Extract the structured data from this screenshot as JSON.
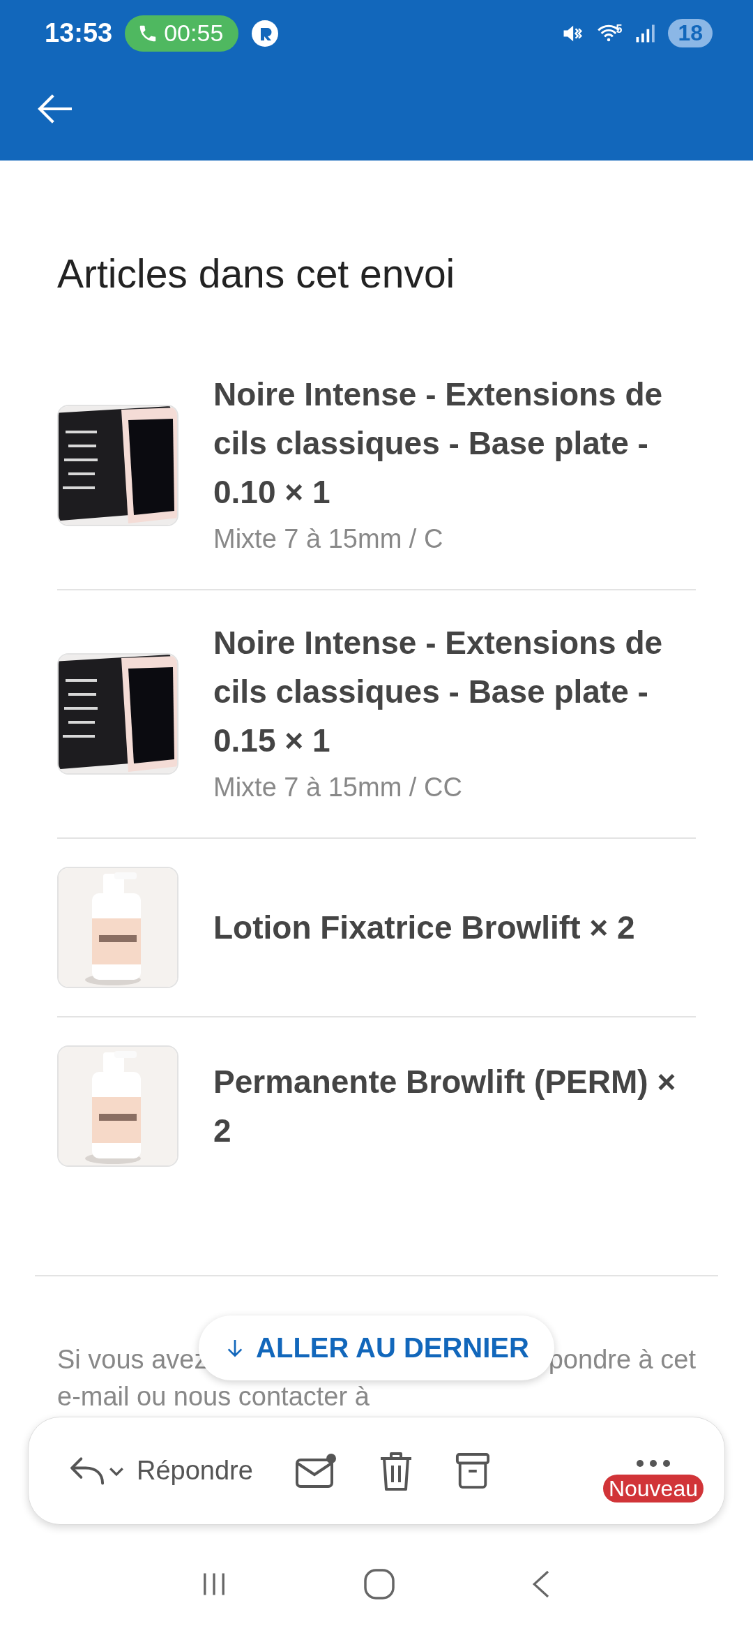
{
  "status_bar": {
    "time": "13:53",
    "call_timer": "00:55",
    "wifi_band": "5",
    "battery": "18"
  },
  "section_title": "Articles dans cet envoi",
  "items": [
    {
      "name": "Noire Intense - Extensions de cils classiques - Base plate - 0.10 × 1",
      "variant": "Mixte 7 à 15mm / C",
      "kind": "lash-palette"
    },
    {
      "name": "Noire Intense - Extensions de cils classiques - Base plate - 0.15 × 1",
      "variant": "Mixte 7 à 15mm / CC",
      "kind": "lash-palette"
    },
    {
      "name": "Lotion Fixatrice Browlift × 2",
      "kind": "bottle"
    },
    {
      "name": "Permanente Browlift (PERM) × 2",
      "kind": "bottle"
    }
  ],
  "jump_button": {
    "label": "ALLER AU DERNIER"
  },
  "message_text": {
    "line_1_start": "Si vous avez",
    "line_1_end": "pondre à cet",
    "line_2": "e-mail ou nous contacter à"
  },
  "toolbar": {
    "reply_label": "Répondre",
    "badge": "Nouveau"
  }
}
